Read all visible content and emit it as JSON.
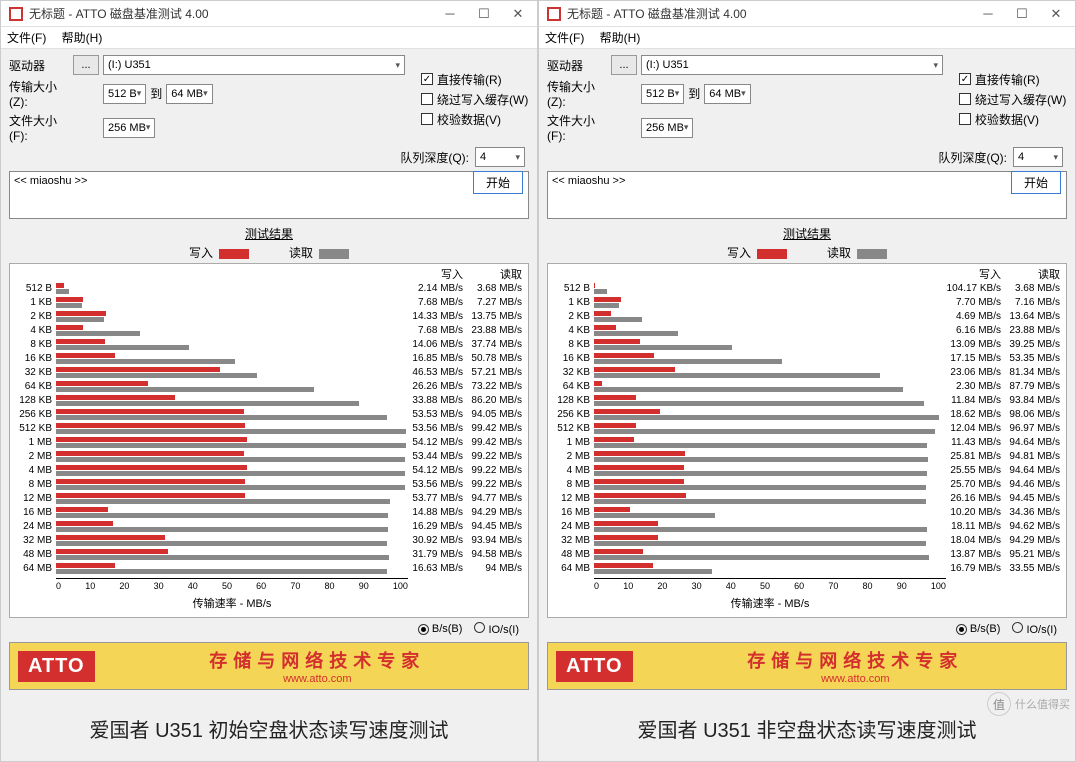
{
  "window": {
    "title": "无标题 - ATTO 磁盘基准测试 4.00",
    "menu_file": "文件(F)",
    "menu_help": "帮助(H)"
  },
  "form": {
    "drive_label": "驱动器",
    "browse": "...",
    "drive_value": "(I:) U351",
    "size_label": "传输大小(Z):",
    "size_from": "512 B",
    "size_to_label": "到",
    "size_to": "64 MB",
    "filesize_label": "文件大小(F):",
    "filesize": "256 MB",
    "opt_direct": "直接传输(R)",
    "opt_bypass": "绕过写入缓存(W)",
    "opt_verify": "校验数据(V)",
    "queue_label": "队列深度(Q):",
    "queue_val": "4",
    "desc": "<< miaoshu >>",
    "start": "开始"
  },
  "results": {
    "title": "测试结果",
    "legend_write": "写入",
    "legend_read": "读取",
    "col_write": "写入",
    "col_read": "读取",
    "xlabel": "传输速率 - MB/s",
    "xticks": [
      "0",
      "10",
      "20",
      "30",
      "40",
      "50",
      "60",
      "70",
      "80",
      "90",
      "100"
    ],
    "radio_bs": "B/s(B)",
    "radio_ios": "IO/s(I)"
  },
  "footer": {
    "logo": "ATTO",
    "slogan": "存储与网络技术专家",
    "site": "www.atto.com"
  },
  "captions": {
    "left": "爱国者 U351 初始空盘状态读写速度测试",
    "right": "爱国者 U351 非空盘状态读写速度测试"
  },
  "watermark": {
    "badge": "值",
    "text": "什么值得买"
  },
  "chart_data": [
    {
      "type": "bar",
      "title": "测试结果 (左)",
      "xlabel": "传输速率 - MB/s",
      "xlim": [
        0,
        100
      ],
      "categories": [
        "512 B",
        "1 KB",
        "2 KB",
        "4 KB",
        "8 KB",
        "16 KB",
        "32 KB",
        "64 KB",
        "128 KB",
        "256 KB",
        "512 KB",
        "1 MB",
        "2 MB",
        "4 MB",
        "8 MB",
        "12 MB",
        "16 MB",
        "24 MB",
        "32 MB",
        "48 MB",
        "64 MB"
      ],
      "series": [
        {
          "name": "写入",
          "unit": "MB/s",
          "values": [
            2.14,
            7.68,
            14.33,
            7.68,
            14.06,
            16.85,
            46.53,
            26.26,
            33.88,
            53.53,
            53.56,
            54.12,
            53.44,
            54.12,
            53.56,
            53.77,
            14.88,
            16.29,
            30.92,
            31.79,
            16.63
          ]
        },
        {
          "name": "读取",
          "unit": "MB/s",
          "values": [
            3.68,
            7.27,
            13.75,
            23.88,
            37.74,
            50.78,
            57.21,
            73.22,
            86.2,
            94.05,
            99.42,
            99.42,
            99.22,
            99.22,
            99.22,
            94.77,
            94.29,
            94.45,
            93.94,
            94.58,
            94
          ]
        }
      ],
      "write_labels": [
        "2.14 MB/s",
        "7.68 MB/s",
        "14.33 MB/s",
        "7.68 MB/s",
        "14.06 MB/s",
        "16.85 MB/s",
        "46.53 MB/s",
        "26.26 MB/s",
        "33.88 MB/s",
        "53.53 MB/s",
        "53.56 MB/s",
        "54.12 MB/s",
        "53.44 MB/s",
        "54.12 MB/s",
        "53.56 MB/s",
        "53.77 MB/s",
        "14.88 MB/s",
        "16.29 MB/s",
        "30.92 MB/s",
        "31.79 MB/s",
        "16.63 MB/s"
      ],
      "read_labels": [
        "3.68 MB/s",
        "7.27 MB/s",
        "13.75 MB/s",
        "23.88 MB/s",
        "37.74 MB/s",
        "50.78 MB/s",
        "57.21 MB/s",
        "73.22 MB/s",
        "86.20 MB/s",
        "94.05 MB/s",
        "99.42 MB/s",
        "99.42 MB/s",
        "99.22 MB/s",
        "99.22 MB/s",
        "99.22 MB/s",
        "94.77 MB/s",
        "94.29 MB/s",
        "94.45 MB/s",
        "93.94 MB/s",
        "94.58 MB/s",
        "94 MB/s"
      ]
    },
    {
      "type": "bar",
      "title": "测试结果 (右)",
      "xlabel": "传输速率 - MB/s",
      "xlim": [
        0,
        100
      ],
      "categories": [
        "512 B",
        "1 KB",
        "2 KB",
        "4 KB",
        "8 KB",
        "16 KB",
        "32 KB",
        "64 KB",
        "128 KB",
        "256 KB",
        "512 KB",
        "1 MB",
        "2 MB",
        "4 MB",
        "8 MB",
        "12 MB",
        "16 MB",
        "24 MB",
        "32 MB",
        "48 MB",
        "64 MB"
      ],
      "series": [
        {
          "name": "写入",
          "unit": "KB/s or MB/s",
          "values_display": [
            "104.17 KB/s",
            "7.70 MB/s",
            "4.69 MB/s",
            "6.16 MB/s",
            "13.09 MB/s",
            "17.15 MB/s",
            "23.06 MB/s",
            "2.30 MB/s",
            "11.84 MB/s",
            "18.62 MB/s",
            "12.04 MB/s",
            "11.43 MB/s",
            "25.81 MB/s",
            "25.55 MB/s",
            "25.70 MB/s",
            "26.16 MB/s",
            "10.20 MB/s",
            "18.11 MB/s",
            "18.04 MB/s",
            "13.87 MB/s",
            "16.79 MB/s"
          ],
          "values_mb": [
            0.1,
            7.7,
            4.69,
            6.16,
            13.09,
            17.15,
            23.06,
            2.3,
            11.84,
            18.62,
            12.04,
            11.43,
            25.81,
            25.55,
            25.7,
            26.16,
            10.2,
            18.11,
            18.04,
            13.87,
            16.79
          ]
        },
        {
          "name": "读取",
          "unit": "MB/s",
          "values": [
            3.68,
            7.16,
            13.64,
            23.88,
            39.25,
            53.35,
            81.34,
            87.79,
            93.84,
            98.06,
            96.97,
            94.64,
            94.81,
            94.64,
            94.46,
            94.45,
            34.36,
            94.62,
            94.29,
            95.21,
            33.55
          ],
          "values_display": [
            "3.68 MB/s",
            "7.16 MB/s",
            "13.64 MB/s",
            "23.88 MB/s",
            "39.25 MB/s",
            "53.35 MB/s",
            "81.34 MB/s",
            "87.79 MB/s",
            "93.84 MB/s",
            "98.06 MB/s",
            "96.97 MB/s",
            "94.64 MB/s",
            "94.81 MB/s",
            "94.64 MB/s",
            "94.46 MB/s",
            "94.45 MB/s",
            "34.36 MB/s",
            "94.62 MB/s",
            "94.29 MB/s",
            "95.21 MB/s",
            "33.55 MB/s"
          ]
        }
      ]
    }
  ]
}
